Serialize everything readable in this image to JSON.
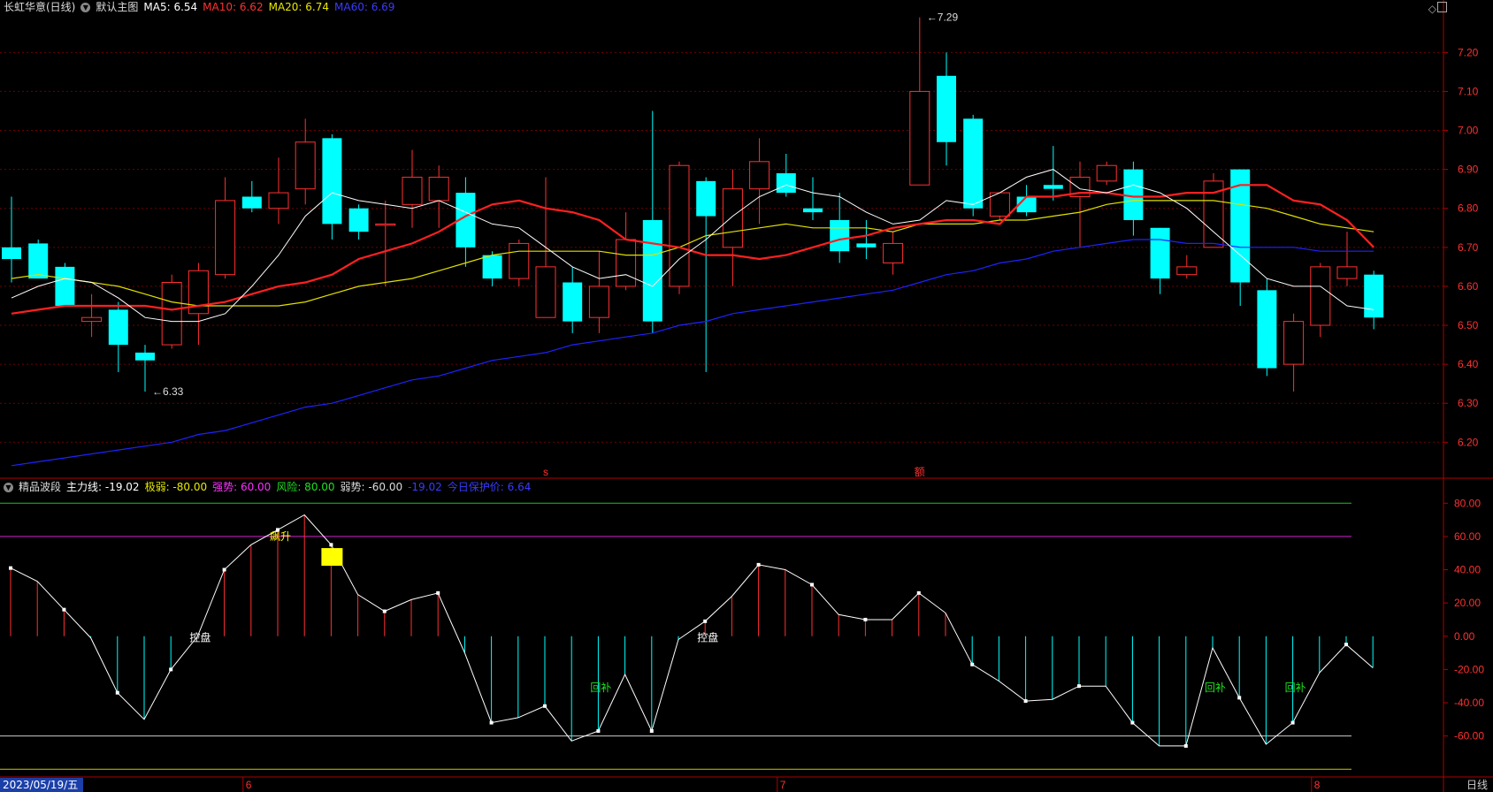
{
  "header": {
    "stock": "长虹华意(日线)",
    "template": "默认主图",
    "ma5": "MA5: 6.54",
    "ma10": "MA10: 6.62",
    "ma20": "MA20: 6.74",
    "ma60": "MA60: 6.69"
  },
  "indicator_header": {
    "name": "精品波段",
    "main": "主力线: -19.02",
    "extreme_weak": "极弱: -80.00",
    "strong": "强势: 60.00",
    "risk": "风险: 80.00",
    "weak": "弱势: -60.00",
    "value": "-19.02",
    "protect": "今日保护价: 6.64"
  },
  "footer": {
    "date": "2023/05/19/五",
    "period": "日线",
    "month_labels": [
      "6",
      "7",
      "8"
    ]
  },
  "colors": {
    "up": "#ff3030",
    "down": "#00ffff",
    "ma5": "#ffffff",
    "ma10": "#ff2020",
    "ma20": "#e0e000",
    "ma60": "#1f22ff",
    "grid": "#700000"
  },
  "chart_data": [
    {
      "type": "candlestick",
      "y_ticks": [
        "7.20",
        "7.10",
        "7.00",
        "6.90",
        "6.80",
        "6.70",
        "6.60",
        "6.50",
        "6.40",
        "6.30",
        "6.20"
      ],
      "ylim": [
        6.11,
        7.33
      ],
      "annotations": [
        {
          "text": "7.29",
          "index": 34,
          "value": 7.29
        },
        {
          "text": "6.33",
          "index": 5,
          "value": 6.33
        }
      ],
      "event_markers": [
        {
          "text": "s",
          "index": 20
        },
        {
          "text": "额",
          "index": 34
        }
      ],
      "candles": [
        {
          "o": 6.7,
          "h": 6.83,
          "l": 6.61,
          "c": 6.67
        },
        {
          "o": 6.71,
          "h": 6.72,
          "l": 6.62,
          "c": 6.62
        },
        {
          "o": 6.65,
          "h": 6.66,
          "l": 6.55,
          "c": 6.55
        },
        {
          "o": 6.51,
          "h": 6.58,
          "l": 6.47,
          "c": 6.52
        },
        {
          "o": 6.54,
          "h": 6.56,
          "l": 6.38,
          "c": 6.45
        },
        {
          "o": 6.43,
          "h": 6.45,
          "l": 6.33,
          "c": 6.41
        },
        {
          "o": 6.45,
          "h": 6.63,
          "l": 6.44,
          "c": 6.61
        },
        {
          "o": 6.53,
          "h": 6.66,
          "l": 6.45,
          "c": 6.64
        },
        {
          "o": 6.63,
          "h": 6.88,
          "l": 6.62,
          "c": 6.82
        },
        {
          "o": 6.83,
          "h": 6.87,
          "l": 6.79,
          "c": 6.8
        },
        {
          "o": 6.8,
          "h": 6.93,
          "l": 6.76,
          "c": 6.84
        },
        {
          "o": 6.85,
          "h": 7.03,
          "l": 6.81,
          "c": 6.97
        },
        {
          "o": 6.98,
          "h": 6.99,
          "l": 6.72,
          "c": 6.76
        },
        {
          "o": 6.8,
          "h": 6.81,
          "l": 6.72,
          "c": 6.74
        },
        {
          "o": 6.76,
          "h": 6.82,
          "l": 6.6,
          "c": 6.76
        },
        {
          "o": 6.81,
          "h": 6.95,
          "l": 6.75,
          "c": 6.88
        },
        {
          "o": 6.82,
          "h": 6.91,
          "l": 6.75,
          "c": 6.88
        },
        {
          "o": 6.84,
          "h": 6.88,
          "l": 6.65,
          "c": 6.7
        },
        {
          "o": 6.68,
          "h": 6.69,
          "l": 6.6,
          "c": 6.62
        },
        {
          "o": 6.62,
          "h": 6.72,
          "l": 6.6,
          "c": 6.71
        },
        {
          "o": 6.52,
          "h": 6.88,
          "l": 6.52,
          "c": 6.65
        },
        {
          "o": 6.61,
          "h": 6.65,
          "l": 6.48,
          "c": 6.51
        },
        {
          "o": 6.52,
          "h": 6.69,
          "l": 6.48,
          "c": 6.6
        },
        {
          "o": 6.6,
          "h": 6.79,
          "l": 6.59,
          "c": 6.72
        },
        {
          "o": 6.77,
          "h": 7.05,
          "l": 6.48,
          "c": 6.51
        },
        {
          "o": 6.6,
          "h": 6.92,
          "l": 6.58,
          "c": 6.91
        },
        {
          "o": 6.87,
          "h": 6.88,
          "l": 6.38,
          "c": 6.78
        },
        {
          "o": 6.7,
          "h": 6.9,
          "l": 6.6,
          "c": 6.85
        },
        {
          "o": 6.85,
          "h": 6.98,
          "l": 6.76,
          "c": 6.92
        },
        {
          "o": 6.89,
          "h": 6.94,
          "l": 6.83,
          "c": 6.84
        },
        {
          "o": 6.8,
          "h": 6.88,
          "l": 6.77,
          "c": 6.79
        },
        {
          "o": 6.77,
          "h": 6.84,
          "l": 6.66,
          "c": 6.69
        },
        {
          "o": 6.71,
          "h": 6.77,
          "l": 6.67,
          "c": 6.7
        },
        {
          "o": 6.66,
          "h": 6.74,
          "l": 6.63,
          "c": 6.71
        },
        {
          "o": 6.86,
          "h": 7.29,
          "l": 6.98,
          "c": 7.1
        },
        {
          "o": 7.14,
          "h": 7.2,
          "l": 6.91,
          "c": 6.97
        },
        {
          "o": 7.03,
          "h": 7.04,
          "l": 6.78,
          "c": 6.8
        },
        {
          "o": 6.78,
          "h": 6.84,
          "l": 6.77,
          "c": 6.84
        },
        {
          "o": 6.83,
          "h": 6.86,
          "l": 6.78,
          "c": 6.79
        },
        {
          "o": 6.86,
          "h": 6.96,
          "l": 6.82,
          "c": 6.85
        },
        {
          "o": 6.83,
          "h": 6.92,
          "l": 6.7,
          "c": 6.88
        },
        {
          "o": 6.87,
          "h": 6.92,
          "l": 6.86,
          "c": 6.91
        },
        {
          "o": 6.9,
          "h": 6.92,
          "l": 6.73,
          "c": 6.77
        },
        {
          "o": 6.75,
          "h": 6.75,
          "l": 6.58,
          "c": 6.62
        },
        {
          "o": 6.63,
          "h": 6.68,
          "l": 6.62,
          "c": 6.65
        },
        {
          "o": 6.7,
          "h": 6.89,
          "l": 6.7,
          "c": 6.87
        },
        {
          "o": 6.9,
          "h": 6.9,
          "l": 6.55,
          "c": 6.61
        },
        {
          "o": 6.59,
          "h": 6.62,
          "l": 6.37,
          "c": 6.39
        },
        {
          "o": 6.4,
          "h": 6.53,
          "l": 6.33,
          "c": 6.51
        },
        {
          "o": 6.5,
          "h": 6.66,
          "l": 6.47,
          "c": 6.65
        },
        {
          "o": 6.62,
          "h": 6.74,
          "l": 6.6,
          "c": 6.65
        },
        {
          "o": 6.63,
          "h": 6.64,
          "l": 6.49,
          "c": 6.52
        }
      ],
      "ma5": [
        6.57,
        6.6,
        6.62,
        6.61,
        6.57,
        6.52,
        6.51,
        6.51,
        6.53,
        6.6,
        6.68,
        6.78,
        6.84,
        6.82,
        6.81,
        6.8,
        6.82,
        6.79,
        6.76,
        6.75,
        6.7,
        6.65,
        6.62,
        6.63,
        6.6,
        6.67,
        6.72,
        6.78,
        6.83,
        6.86,
        6.84,
        6.83,
        6.79,
        6.76,
        6.77,
        6.82,
        6.81,
        6.84,
        6.88,
        6.9,
        6.85,
        6.84,
        6.86,
        6.84,
        6.8,
        6.74,
        6.68,
        6.62,
        6.6,
        6.6,
        6.55,
        6.54
      ],
      "ma10": [
        6.53,
        6.54,
        6.55,
        6.55,
        6.55,
        6.55,
        6.54,
        6.55,
        6.56,
        6.58,
        6.6,
        6.61,
        6.63,
        6.67,
        6.69,
        6.71,
        6.74,
        6.78,
        6.81,
        6.82,
        6.8,
        6.79,
        6.77,
        6.72,
        6.71,
        6.7,
        6.68,
        6.68,
        6.67,
        6.68,
        6.7,
        6.72,
        6.73,
        6.75,
        6.76,
        6.77,
        6.77,
        6.76,
        6.83,
        6.83,
        6.84,
        6.84,
        6.83,
        6.83,
        6.84,
        6.84,
        6.86,
        6.86,
        6.82,
        6.81,
        6.77,
        6.7,
        6.67,
        6.65,
        6.62
      ],
      "ma20": [
        6.62,
        6.63,
        6.62,
        6.61,
        6.6,
        6.58,
        6.56,
        6.55,
        6.55,
        6.55,
        6.55,
        6.56,
        6.58,
        6.6,
        6.61,
        6.62,
        6.64,
        6.66,
        6.68,
        6.69,
        6.69,
        6.69,
        6.69,
        6.68,
        6.68,
        6.7,
        6.73,
        6.74,
        6.75,
        6.76,
        6.75,
        6.75,
        6.75,
        6.74,
        6.76,
        6.76,
        6.76,
        6.77,
        6.77,
        6.78,
        6.79,
        6.81,
        6.82,
        6.82,
        6.82,
        6.82,
        6.81,
        6.8,
        6.78,
        6.76,
        6.75,
        6.74
      ],
      "ma60": [
        6.14,
        6.15,
        6.16,
        6.17,
        6.18,
        6.19,
        6.2,
        6.22,
        6.23,
        6.25,
        6.27,
        6.29,
        6.3,
        6.32,
        6.34,
        6.36,
        6.37,
        6.39,
        6.41,
        6.42,
        6.43,
        6.45,
        6.46,
        6.47,
        6.48,
        6.5,
        6.51,
        6.53,
        6.54,
        6.55,
        6.56,
        6.57,
        6.58,
        6.59,
        6.61,
        6.63,
        6.64,
        6.66,
        6.67,
        6.69,
        6.7,
        6.71,
        6.72,
        6.72,
        6.71,
        6.71,
        6.7,
        6.7,
        6.7,
        6.69,
        6.69,
        6.69
      ]
    },
    {
      "type": "line",
      "name": "精品波段",
      "y_ticks": [
        "80.00",
        "60.00",
        "40.00",
        "20.00",
        "0.00",
        "-20.00",
        "-40.00",
        "-60.00"
      ],
      "ylim": [
        -82,
        86
      ],
      "reference_lines": [
        80,
        60,
        -60,
        -80
      ],
      "values": [
        41,
        33,
        16,
        -1,
        -34,
        -50,
        -20,
        0,
        40,
        55,
        64,
        73,
        55,
        25,
        15,
        22,
        26,
        -10,
        -52,
        -49,
        -42,
        -63,
        -57,
        -23,
        -57,
        -2,
        9,
        24,
        43,
        40,
        31,
        13,
        10,
        10,
        26,
        14,
        -17,
        -27,
        -39,
        -38,
        -30,
        -30,
        -52,
        -66,
        -66,
        -7,
        -37,
        -65,
        -52,
        -22,
        -5,
        -19
      ],
      "labels": [
        {
          "text": "飙升",
          "index": 10,
          "value": 60
        },
        {
          "text": "控盘",
          "index": 7,
          "value": -1
        },
        {
          "text": "控盘",
          "index": 26,
          "value": -1
        },
        {
          "text": "回补",
          "index": 22,
          "value": -31
        },
        {
          "text": "回补",
          "index": 45,
          "value": -31
        },
        {
          "text": "回补",
          "index": 48,
          "value": -31
        }
      ]
    }
  ]
}
